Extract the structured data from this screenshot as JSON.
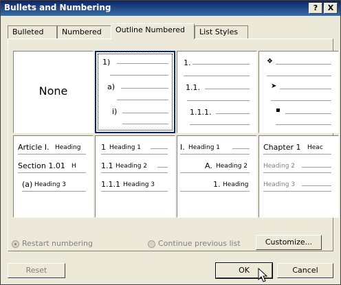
{
  "dialog": {
    "title": "Bullets and Numbering",
    "help_label": "?",
    "close_label": "X"
  },
  "tabs": [
    {
      "label": "Bulleted"
    },
    {
      "label": "Numbered"
    },
    {
      "label": "Outline Numbered",
      "active": true
    },
    {
      "label": "List Styles"
    }
  ],
  "gallery": {
    "none_label": "None",
    "cell1": [
      "1)",
      "a)",
      "i)"
    ],
    "cell2": [
      "1.",
      "1.1.",
      "1.1.1."
    ],
    "cell3_symbols": [
      "❖",
      "➤",
      "▪"
    ],
    "cell4": [
      "Article I.",
      "Heading",
      "Section 1.01",
      "H",
      "(a)",
      "Heading 3"
    ],
    "cell5": [
      "1",
      "Heading 1",
      "1.1",
      "Heading 2",
      "1.1.1",
      "Heading 3"
    ],
    "cell6": [
      "I.",
      "Heading 1",
      "A.",
      "Heading 2",
      "1.",
      "Heading"
    ],
    "cell7": [
      "Chapter 1",
      "Heac",
      "Heading 2",
      "Heading 3"
    ]
  },
  "options": {
    "restart_label": "Restart numbering",
    "continue_label": "Continue previous list",
    "customize_label": "Customize..."
  },
  "footer": {
    "reset_label": "Reset",
    "ok_label": "OK",
    "cancel_label": "Cancel"
  }
}
